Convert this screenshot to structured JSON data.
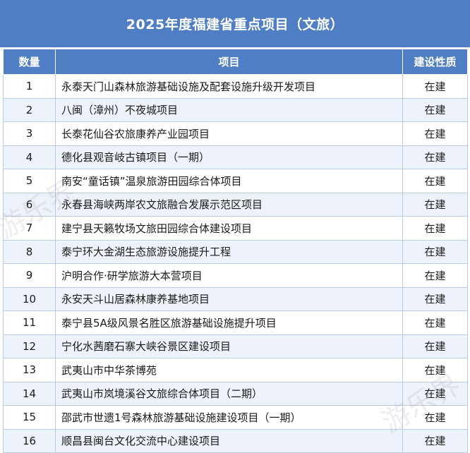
{
  "title": "2025年度福建省重点项目（文旅）",
  "headers": {
    "count": "数量",
    "project": "项目",
    "nature": "建设性质"
  },
  "rows": [
    {
      "num": "1",
      "name": "永泰天门山森林旅游基础设施及配套设施升级开发项目",
      "status": "在建"
    },
    {
      "num": "2",
      "name": "八闽（漳州）不夜城项目",
      "status": "在建"
    },
    {
      "num": "3",
      "name": "长泰花仙谷农旅康养产业园项目",
      "status": "在建"
    },
    {
      "num": "4",
      "name": "德化县观音岐古镇项目（一期）",
      "status": "在建"
    },
    {
      "num": "5",
      "name": "南安“童话镇”温泉旅游田园综合体项目",
      "status": "在建"
    },
    {
      "num": "6",
      "name": "永春县海峡两岸农文旅融合发展示范区项目",
      "status": "在建"
    },
    {
      "num": "7",
      "name": "建宁县天籁牧场文旅田园综合体建设项目",
      "status": "在建"
    },
    {
      "num": "8",
      "name": "泰宁环大金湖生态旅游设施提升工程",
      "status": "在建"
    },
    {
      "num": "9",
      "name": "沪明合作·研学旅游大本营项目",
      "status": "在建"
    },
    {
      "num": "10",
      "name": "永安天斗山居森林康养基地项目",
      "status": "在建"
    },
    {
      "num": "11",
      "name": "泰宁县5A级风景名胜区旅游基础设施提升项目",
      "status": "在建"
    },
    {
      "num": "12",
      "name": "宁化水茜磨石寨大峡谷景区建设项目",
      "status": "在建"
    },
    {
      "num": "13",
      "name": "武夷山市中华茶博苑",
      "status": "在建"
    },
    {
      "num": "14",
      "name": "武夷山市岚境溪谷文旅综合体项目（二期）",
      "status": "在建"
    },
    {
      "num": "15",
      "name": "邵武市世遗1号森林旅游基础设施建设项目（一期）",
      "status": "在建"
    },
    {
      "num": "16",
      "name": "顺昌县闽台文化交流中心建设项目",
      "status": "在建"
    }
  ],
  "watermark": {
    "text_a": "游乐界",
    "text_b": "游乐界"
  }
}
